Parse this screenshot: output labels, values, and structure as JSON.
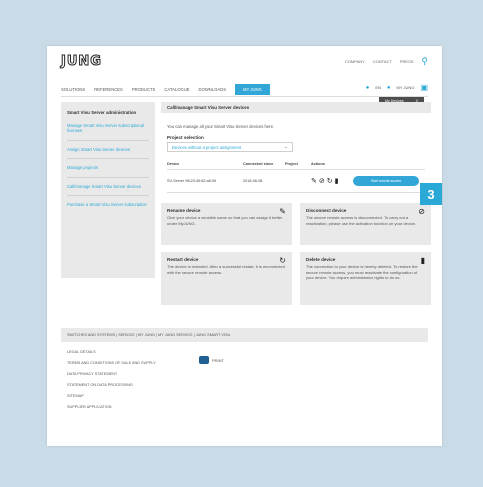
{
  "brand": {
    "logo": "JUNG"
  },
  "meta_nav": {
    "company": "COMPANY",
    "contact": "CONTACT",
    "press": "PRESS"
  },
  "main_nav": {
    "items": [
      "SOLUTIONS",
      "REFERENCES",
      "PRODUCTS",
      "CATALOGUE",
      "DOWNLOADS"
    ],
    "active": "MY JUNG"
  },
  "nav_right": {
    "language": "EN",
    "account": "MY JUNG"
  },
  "breadcrumb": {
    "label": "My Devices",
    "close": "X"
  },
  "sidebar": {
    "heading": "Smart Visu Server administration",
    "items": [
      "Manage Smart Visu Server subscriptional licenses",
      "Assign Smart Visu Server devices",
      "Manage projects",
      "Call/manage Smart Visu Server devices",
      "Purchase a Smart Visu Server subscription"
    ]
  },
  "content": {
    "title": "Call/manage Smart Visu Server devices",
    "intro": "You can manage all your Smart Visu Server devices here.",
    "project_label": "Project selection",
    "project_value": "Devices without a project assignment",
    "table": {
      "headers": [
        "Device",
        "Connected since",
        "Project",
        "Actions"
      ],
      "row": {
        "device": "SV-Server 98:23:45:62:a8:39",
        "since": "2018-06-08",
        "project": ""
      },
      "start_button": "Start remote access"
    },
    "cards": [
      {
        "title": "Rename device",
        "text": "Give your device a sensible name so that you can assign it better under MyJUNG."
      },
      {
        "title": "Disconnect device",
        "text": "The secure remote access is disconnected. To carry out a reactivation, please use the activation function on your device."
      },
      {
        "title": "Restart device",
        "text": "The device is restarted. After a successful restart, it is reconnected with the secure remote access."
      },
      {
        "title": "Delete device",
        "text": "The connection to your device is hereby deleted. To restore the secure remote access, you must reactivate the configuration of your device. You require administrator rights to do so."
      }
    ]
  },
  "footer": {
    "bar": "SWITCHES AND SYSTEMS  |  SERVICE  |  MY JUNG  |  MY JUNG SERVICE  |  JUNG SMART VISU",
    "links": [
      "LEGAL DETAILS",
      "TERMS AND CONDITIONS OF SALE AND SUPPLY",
      "DATA PRIVACY STATEMENT",
      "STATEMENT ON DATA PROCESSING",
      "SITEMAP",
      "SUPPLIER APPLICATION"
    ],
    "print": "PRINT"
  },
  "callout": {
    "number": "3",
    "color": "#2aa8d6"
  },
  "colors": {
    "accent": "#33a6d8",
    "background": "#c9dbe7",
    "panel": "#e9e9e9"
  },
  "icons": [
    "search-icon",
    "flag-icon",
    "user-icon",
    "cart-icon",
    "pencil-icon",
    "disconnect-icon",
    "restart-icon",
    "trash-icon",
    "print-icon"
  ]
}
